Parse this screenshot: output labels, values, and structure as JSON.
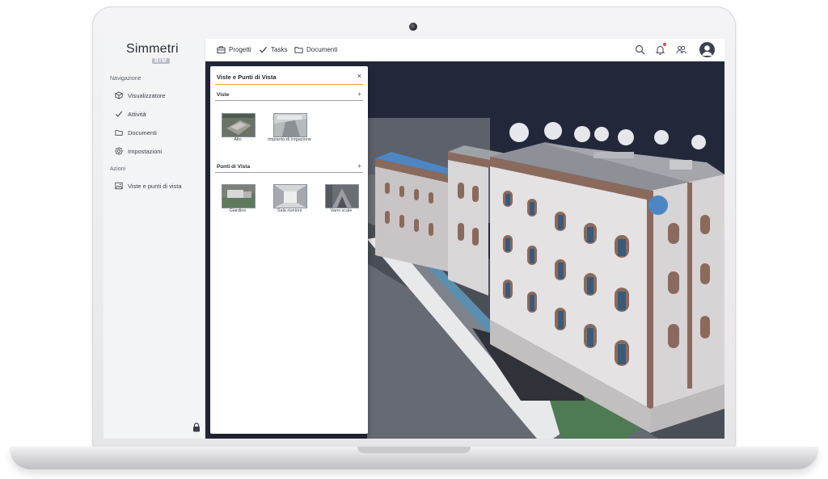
{
  "app": {
    "logo_main": "Simmetri",
    "logo_sub": "BIM"
  },
  "sidebar": {
    "section_navigation": "Navigazione",
    "nav": [
      {
        "label": "Visualizzatore",
        "icon": "cube-icon"
      },
      {
        "label": "Attività",
        "icon": "check-icon"
      },
      {
        "label": "Documenti",
        "icon": "folder-icon"
      },
      {
        "label": "Impostazioni",
        "icon": "gear-icon"
      }
    ],
    "section_actions": "Azioni",
    "actions": [
      {
        "label": "Viste e punti di vista",
        "icon": "image-icon"
      }
    ]
  },
  "topbar": {
    "items": [
      {
        "label": "Progetti",
        "icon": "briefcase-icon"
      },
      {
        "label": "Tasks",
        "icon": "check-icon"
      },
      {
        "label": "Documenti",
        "icon": "folder-icon"
      }
    ],
    "icons": [
      "search-icon",
      "bell-icon",
      "users-icon",
      "avatar"
    ]
  },
  "panel": {
    "title": "Viste e Punti di Vista",
    "close": "×",
    "views_label": "Viste",
    "views_add": "+",
    "views": [
      {
        "caption": "Alto"
      },
      {
        "caption": "Impianto di irrigazione"
      }
    ],
    "points_label": "Punti di Vista",
    "points_add": "+",
    "points": [
      {
        "caption": "Giardino"
      },
      {
        "caption": "Sala riunioni"
      },
      {
        "caption": "Vano scale"
      }
    ]
  },
  "colors": {
    "accent": "#f0a33a",
    "notification": "#e5484d",
    "viewport_bg": "#22273a",
    "facade_brown": "#8a6a5c"
  }
}
